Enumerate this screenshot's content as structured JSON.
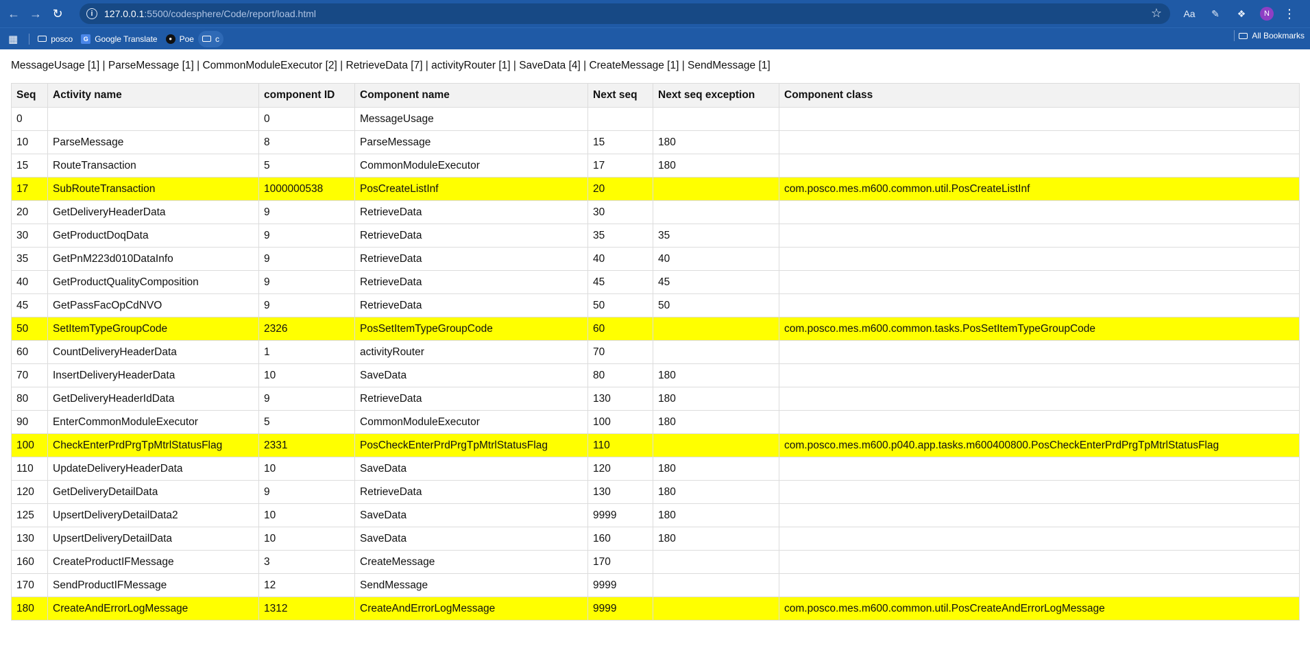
{
  "browser": {
    "url_host": "127.0.0.1",
    "url_rest": ":5500/codesphere/Code/report/load.html",
    "avatar_initial": "N",
    "bookmarks": [
      {
        "label": "posco",
        "icon": "folder-icon"
      },
      {
        "label": "Google Translate",
        "icon": "google-translate-icon"
      },
      {
        "label": "Poe",
        "icon": "poe-icon"
      },
      {
        "label": "c",
        "icon": "folder-icon"
      }
    ],
    "all_bookmarks_label": "All Bookmarks"
  },
  "summary_text": "MessageUsage [1] | ParseMessage [1] | CommonModuleExecutor [2] | RetrieveData [7] | activityRouter [1] | SaveData [4] | CreateMessage [1] | SendMessage [1]",
  "table": {
    "columns": [
      "Seq",
      "Activity name",
      "component ID",
      "Component name",
      "Next seq",
      "Next seq exception",
      "Component class"
    ],
    "highlight_color": "#ffff00",
    "rows": [
      {
        "cells": [
          "0",
          "",
          "0",
          "MessageUsage",
          "",
          "",
          ""
        ],
        "highlight": false
      },
      {
        "cells": [
          "10",
          "ParseMessage",
          "8",
          "ParseMessage",
          "15",
          "180",
          ""
        ],
        "highlight": false
      },
      {
        "cells": [
          "15",
          "RouteTransaction",
          "5",
          "CommonModuleExecutor",
          "17",
          "180",
          ""
        ],
        "highlight": false
      },
      {
        "cells": [
          "17",
          "SubRouteTransaction",
          "1000000538",
          "PosCreateListInf",
          "20",
          "",
          "com.posco.mes.m600.common.util.PosCreateListInf"
        ],
        "highlight": true
      },
      {
        "cells": [
          "20",
          "GetDeliveryHeaderData",
          "9",
          "RetrieveData",
          "30",
          "",
          ""
        ],
        "highlight": false
      },
      {
        "cells": [
          "30",
          "GetProductDoqData",
          "9",
          "RetrieveData",
          "35",
          "35",
          ""
        ],
        "highlight": false
      },
      {
        "cells": [
          "35",
          "GetPnM223d010DataInfo",
          "9",
          "RetrieveData",
          "40",
          "40",
          ""
        ],
        "highlight": false
      },
      {
        "cells": [
          "40",
          "GetProductQualityComposition",
          "9",
          "RetrieveData",
          "45",
          "45",
          ""
        ],
        "highlight": false
      },
      {
        "cells": [
          "45",
          "GetPassFacOpCdNVO",
          "9",
          "RetrieveData",
          "50",
          "50",
          ""
        ],
        "highlight": false
      },
      {
        "cells": [
          "50",
          "SetItemTypeGroupCode",
          "2326",
          "PosSetItemTypeGroupCode",
          "60",
          "",
          "com.posco.mes.m600.common.tasks.PosSetItemTypeGroupCode"
        ],
        "highlight": true
      },
      {
        "cells": [
          "60",
          "CountDeliveryHeaderData",
          "1",
          "activityRouter",
          "70",
          "",
          ""
        ],
        "highlight": false
      },
      {
        "cells": [
          "70",
          "InsertDeliveryHeaderData",
          "10",
          "SaveData",
          "80",
          "180",
          ""
        ],
        "highlight": false
      },
      {
        "cells": [
          "80",
          "GetDeliveryHeaderIdData",
          "9",
          "RetrieveData",
          "130",
          "180",
          ""
        ],
        "highlight": false
      },
      {
        "cells": [
          "90",
          "EnterCommonModuleExecutor",
          "5",
          "CommonModuleExecutor",
          "100",
          "180",
          ""
        ],
        "highlight": false
      },
      {
        "cells": [
          "100",
          "CheckEnterPrdPrgTpMtrlStatusFlag",
          "2331",
          "PosCheckEnterPrdPrgTpMtrlStatusFlag",
          "110",
          "",
          "com.posco.mes.m600.p040.app.tasks.m600400800.PosCheckEnterPrdPrgTpMtrlStatusFlag"
        ],
        "highlight": true
      },
      {
        "cells": [
          "110",
          "UpdateDeliveryHeaderData",
          "10",
          "SaveData",
          "120",
          "180",
          ""
        ],
        "highlight": false
      },
      {
        "cells": [
          "120",
          "GetDeliveryDetailData",
          "9",
          "RetrieveData",
          "130",
          "180",
          ""
        ],
        "highlight": false
      },
      {
        "cells": [
          "125",
          "UpsertDeliveryDetailData2",
          "10",
          "SaveData",
          "9999",
          "180",
          ""
        ],
        "highlight": false
      },
      {
        "cells": [
          "130",
          "UpsertDeliveryDetailData",
          "10",
          "SaveData",
          "160",
          "180",
          ""
        ],
        "highlight": false
      },
      {
        "cells": [
          "160",
          "CreateProductIFMessage",
          "3",
          "CreateMessage",
          "170",
          "",
          ""
        ],
        "highlight": false
      },
      {
        "cells": [
          "170",
          "SendProductIFMessage",
          "12",
          "SendMessage",
          "9999",
          "",
          ""
        ],
        "highlight": false
      },
      {
        "cells": [
          "180",
          "CreateAndErrorLogMessage",
          "1312",
          "CreateAndErrorLogMessage",
          "9999",
          "",
          "com.posco.mes.m600.common.util.PosCreateAndErrorLogMessage"
        ],
        "highlight": true
      }
    ]
  }
}
